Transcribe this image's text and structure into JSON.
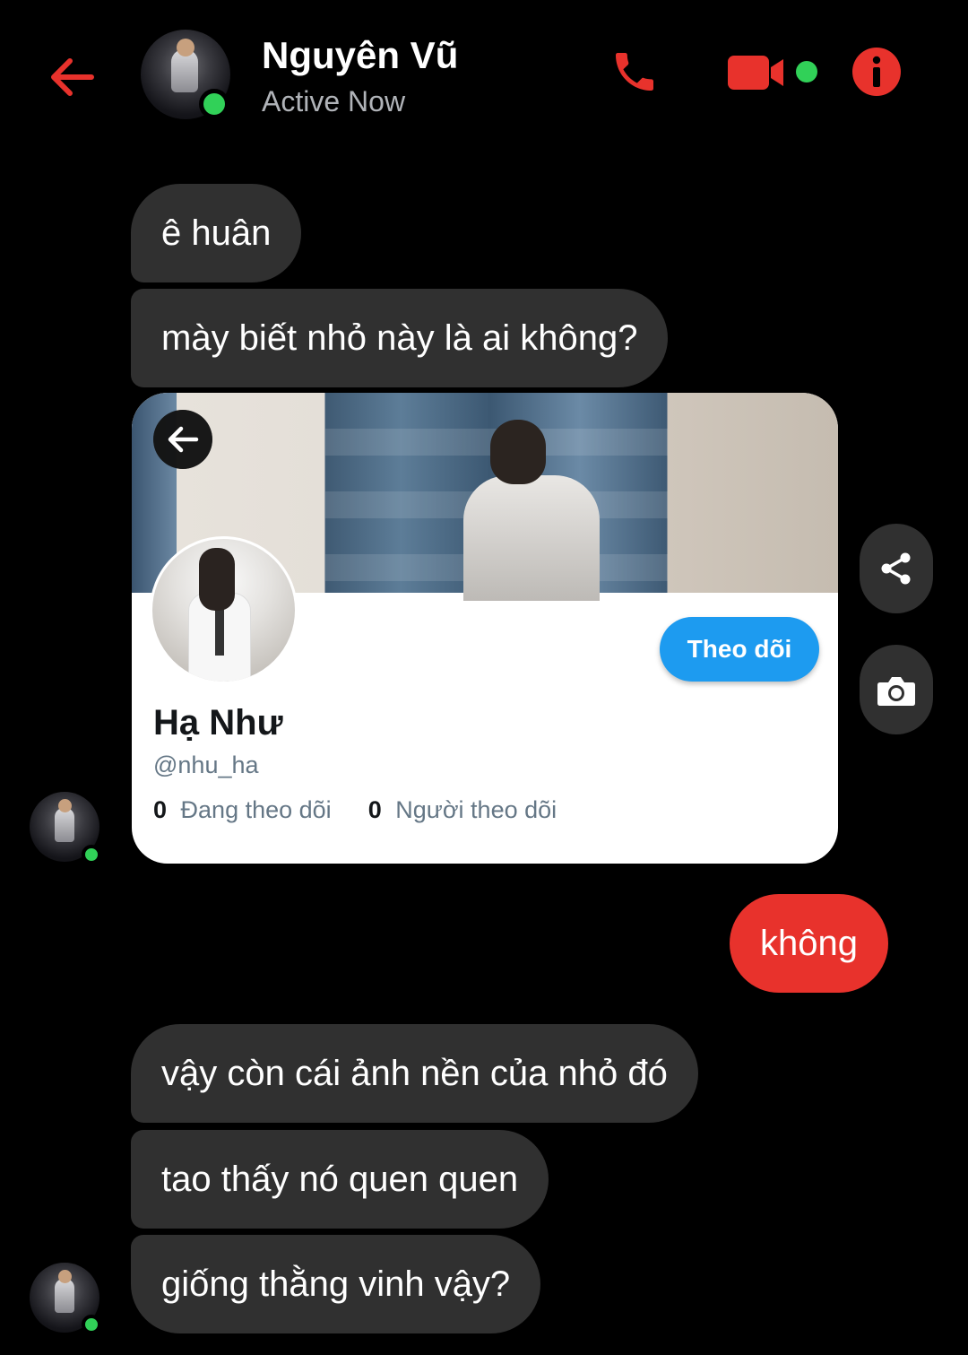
{
  "header": {
    "contact_name": "Nguyên Vũ",
    "status": "Active Now",
    "accent_color": "#e8322c",
    "online_color": "#31d158"
  },
  "messages": {
    "m1": "ê huân",
    "m2": "mày biết nhỏ này là ai không?",
    "m3": "không",
    "m4": "vậy còn cái ảnh nền của nhỏ đó",
    "m5": "tao thấy nó quen quen",
    "m6": "giống thằng vinh vậy?"
  },
  "profile_card": {
    "name": "Hạ Như",
    "handle": "@nhu_ha",
    "follow_label": "Theo dõi",
    "following_count": "0",
    "following_label": "Đang theo dõi",
    "followers_count": "0",
    "followers_label": "Người theo dõi"
  },
  "icons": {
    "back": "arrow-left-icon",
    "call": "phone-icon",
    "video": "video-camera-icon",
    "info": "info-icon",
    "share": "share-icon",
    "camera": "camera-icon"
  }
}
